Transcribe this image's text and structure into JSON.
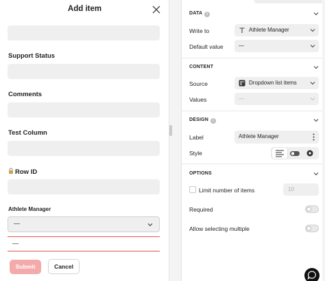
{
  "modal": {
    "title": "Add item",
    "fields": {
      "support_status_label": "Support Status",
      "comments_label": "Comments",
      "test_column_label": "Test Column",
      "row_id_label": "Row ID",
      "row_id_icon": "lock-icon",
      "athlete_manager_label": "Athlete Manager",
      "athlete_manager_value": "—",
      "dropdown_option": "—"
    },
    "submit_label": "Submit",
    "cancel_label": "Cancel"
  },
  "settings": {
    "data": {
      "heading": "DATA",
      "write_to_label": "Write to",
      "write_to_value": "Athlete Manager",
      "default_value_label": "Default value",
      "default_value_value": "—"
    },
    "content": {
      "heading": "CONTENT",
      "source_label": "Source",
      "source_value": "Dropdown list items",
      "values_label": "Values",
      "values_value": "—"
    },
    "design": {
      "heading": "DESIGN",
      "label_label": "Label",
      "label_value": "Athlete Manager",
      "style_label": "Style"
    },
    "options": {
      "heading": "OPTIONS",
      "limit_label": "Limit number of items",
      "limit_value": "10",
      "required_label": "Required",
      "allow_multiple_label": "Allow selecting multiple"
    }
  },
  "colors": {
    "accent": "#e55353",
    "submit_disabled": "#f4aaaa",
    "field_bg": "#efefef"
  }
}
